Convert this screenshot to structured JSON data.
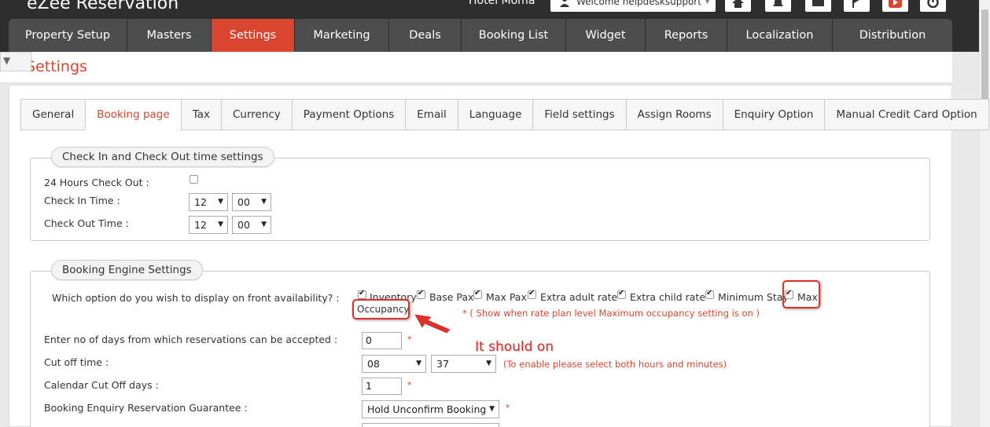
{
  "app": {
    "logo": "eZee Reservation",
    "hotel": "Hotel Moma",
    "welcome": "Welcome helpdesksupport"
  },
  "nav": [
    {
      "label": "Property Setup"
    },
    {
      "label": "Masters"
    },
    {
      "label": "Settings",
      "active": true
    },
    {
      "label": "Marketing"
    },
    {
      "label": "Deals"
    },
    {
      "label": "Booking List"
    },
    {
      "label": "Widget"
    },
    {
      "label": "Reports"
    },
    {
      "label": "Localization"
    },
    {
      "label": "Distribution"
    }
  ],
  "page_title": "Settings",
  "tabs": [
    {
      "label": "General"
    },
    {
      "label": "Booking page",
      "active": true
    },
    {
      "label": "Tax"
    },
    {
      "label": "Currency"
    },
    {
      "label": "Payment Options"
    },
    {
      "label": "Email"
    },
    {
      "label": "Language"
    },
    {
      "label": "Field settings"
    },
    {
      "label": "Assign Rooms"
    },
    {
      "label": "Enquiry Option"
    },
    {
      "label": "Manual Credit Card Option"
    }
  ],
  "checkin": {
    "legend": "Check In and Check Out time settings",
    "hours24_label": "24 Hours Check Out :",
    "hours24_checked": false,
    "checkin_label": "Check In Time :",
    "checkin_hour": "12",
    "checkin_min": "00",
    "checkout_label": "Check Out Time :",
    "checkout_hour": "12",
    "checkout_min": "00"
  },
  "engine": {
    "legend": "Booking Engine Settings",
    "question": "Which option do you wish to display on front availability? :",
    "options": [
      {
        "label": "Inventory",
        "checked": true
      },
      {
        "label": "Base Pax",
        "checked": true
      },
      {
        "label": "Max Pax",
        "checked": true
      },
      {
        "label": "Extra adult rate",
        "checked": true
      },
      {
        "label": "Extra child rate",
        "checked": true
      },
      {
        "label": "Minimum Stay",
        "checked": true
      },
      {
        "label": "Max",
        "checked": true
      }
    ],
    "option_wrap": "Occupancy",
    "option_note": "* ( Show when rate plan level Maximum occupancy setting is on )",
    "days_label": "Enter no of days from which reservations can be accepted :",
    "days_value": "0",
    "cutoff_label": "Cut off time :",
    "cutoff_hour": "08",
    "cutoff_min": "37",
    "cutoff_note": "(To enable please select both hours and minutes)",
    "cal_label": "Calendar Cut Off days :",
    "cal_value": "1",
    "guarantee_label": "Booking Enquiry Reservation Guarantee :",
    "guarantee_value": "Hold Unconfirm Booking",
    "required_mark": "*"
  },
  "annotation": {
    "text": "It should on",
    "color": "#e0302a"
  },
  "colors": {
    "accent": "#d9452f",
    "nav_bg": "#4d4d4d",
    "topbar": "#2e2e2e"
  }
}
